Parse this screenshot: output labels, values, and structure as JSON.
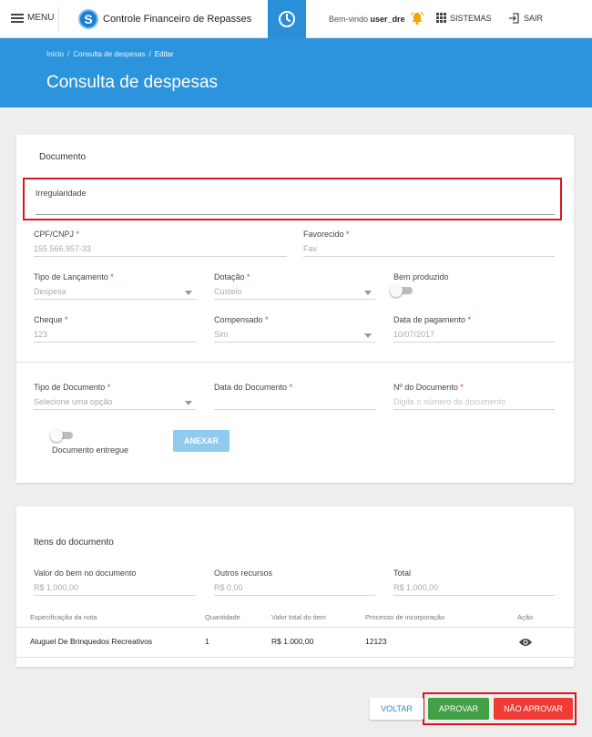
{
  "header": {
    "menu_label": "MENU",
    "brand_logo_letter": "S",
    "app_title": "Controle Financeiro de Repasses",
    "welcome_prefix": "Bem-vindo",
    "username": "user_dre",
    "sistemas_label": "SISTEMAS",
    "sair_label": "SAIR"
  },
  "breadcrumb": {
    "items": [
      "Início",
      "Consulta de despesas",
      "Editar"
    ],
    "separator": "/"
  },
  "page_title": "Consulta de despesas",
  "documento": {
    "section_title": "Documento",
    "irregularidade_label": "Irregularidade",
    "cpf_label": "CPF/CNPJ",
    "cpf_value": "155.566.957-33",
    "favorecido_label": "Favorecido",
    "favorecido_value": "Fav",
    "tipo_lancamento_label": "Tipo de Lançamento",
    "tipo_lancamento_value": "Despesa",
    "dotacao_label": "Dotação",
    "dotacao_value": "Custeio",
    "bem_produzido_label": "Bem produzido",
    "cheque_label": "Cheque",
    "cheque_value": "123",
    "compensado_label": "Compensado",
    "compensado_value": "Sim",
    "data_pagamento_label": "Data de pagamento",
    "data_pagamento_value": "10/07/2017",
    "tipo_documento_label": "Tipo de Documento",
    "tipo_documento_placeholder": "Selecione uma opção",
    "data_documento_label": "Data do Documento",
    "numero_documento_label": "Nº do Documento",
    "numero_documento_placeholder": "Digite o número do documento",
    "documento_entregue_label": "Documento entregue",
    "anexar_label": "ANEXAR",
    "required_mark": "*"
  },
  "itens": {
    "section_title": "Itens do documento",
    "valor_bem_label": "Valor do bem no documento",
    "valor_bem_value": "R$ 1.000,00",
    "outros_recursos_label": "Outros recursos",
    "outros_recursos_value": "R$ 0,00",
    "total_label": "Total",
    "total_value": "R$ 1.000,00",
    "table": {
      "headers": [
        "Especificação da nota",
        "Quantidade",
        "Valor total do item",
        "Processo de incorporação",
        "Ação"
      ],
      "rows": [
        [
          "Aluguel De Brinquedos Recreativos",
          "1",
          "R$ 1.000,00",
          "12123"
        ]
      ]
    }
  },
  "actions": {
    "voltar_label": "VOLTAR",
    "aprovar_label": "APROVAR",
    "nao_aprovar_label": "NÃO APROVAR"
  },
  "colors": {
    "primary": "#2c94dc",
    "approve": "#43a047",
    "reject": "#ef3b36",
    "highlight": "#d9161d",
    "required": "#e53935"
  },
  "toggles": {
    "bem_produzido_on": false,
    "documento_entregue_on": false
  }
}
